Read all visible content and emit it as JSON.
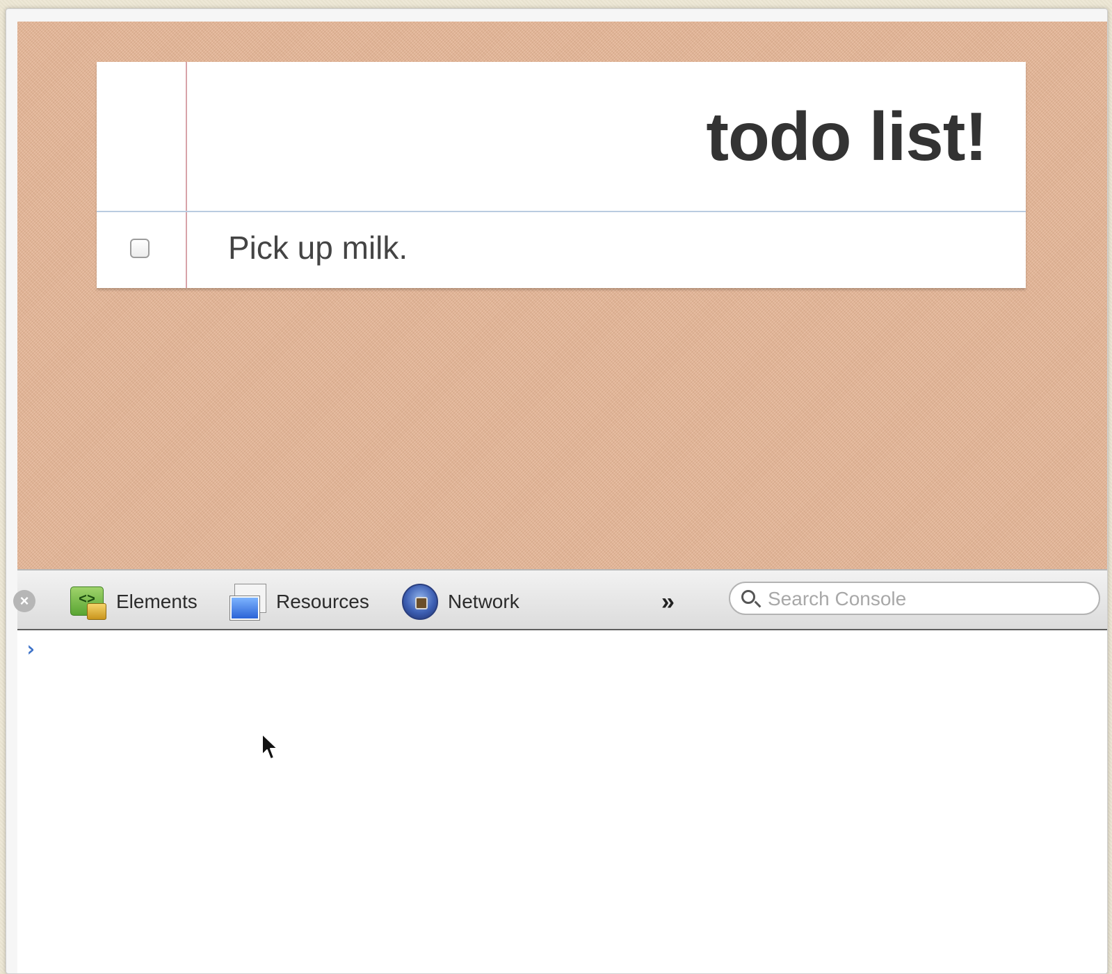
{
  "todo": {
    "title": "todo list!",
    "items": [
      {
        "text": "Pick up milk.",
        "checked": false
      }
    ]
  },
  "devtools": {
    "close_icon": "close-icon",
    "tabs": [
      {
        "label": "Elements",
        "icon": "elements-icon"
      },
      {
        "label": "Resources",
        "icon": "resources-icon"
      },
      {
        "label": "Network",
        "icon": "network-icon"
      }
    ],
    "more_label": "»",
    "search": {
      "placeholder": "Search Console",
      "value": ""
    },
    "console": {
      "prompt": "›",
      "input_value": ""
    }
  },
  "colors": {
    "page_background": "#e7b797",
    "card": "#ffffff",
    "margin_line": "#d8a3a9",
    "rule_line": "#b9cbe0",
    "title_text": "#333333",
    "prompt": "#3f74c9"
  }
}
